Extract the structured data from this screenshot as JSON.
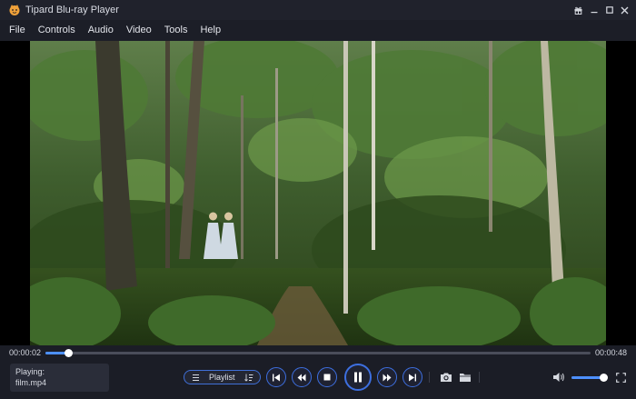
{
  "window": {
    "title": "Tipard Blu-ray Player"
  },
  "menu": {
    "items": [
      "File",
      "Controls",
      "Audio",
      "Video",
      "Tools",
      "Help"
    ]
  },
  "player": {
    "current_time": "00:00:02",
    "duration": "00:00:48",
    "progress_fraction": 0.042,
    "playing_label": "Playing:",
    "file_name": "film.mp4",
    "playlist_label": "Playlist",
    "volume_fraction": 0.88
  },
  "colors": {
    "accent": "#3d6fe0",
    "background": "#1b1d26",
    "progress": "#4d90ff"
  },
  "icons": {
    "logo": "tipard-logo-icon",
    "titlebar": [
      "gift-icon",
      "minimize-icon",
      "maximize-icon",
      "close-icon"
    ],
    "controls": [
      "playlist-icon",
      "sort-icon",
      "previous-icon",
      "rewind-icon",
      "stop-icon",
      "pause-icon",
      "fast-forward-icon",
      "next-icon",
      "camera-icon",
      "folder-icon",
      "volume-icon",
      "fullscreen-icon"
    ]
  }
}
